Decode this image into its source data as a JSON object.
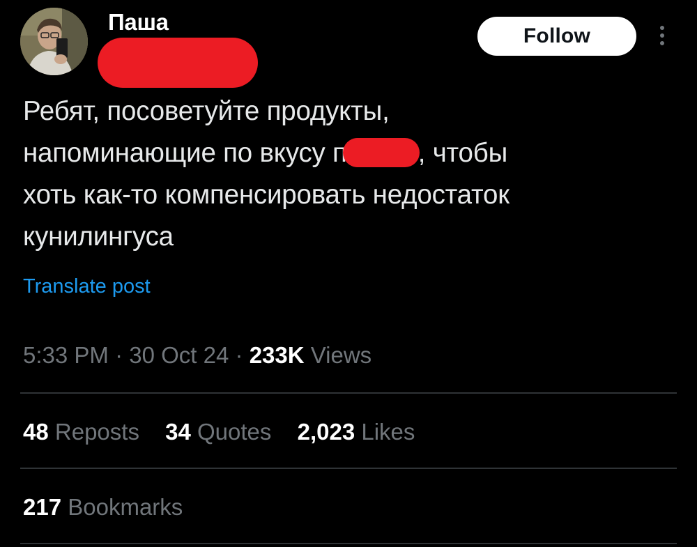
{
  "author": {
    "display_name": "Паша",
    "handle_redacted": true
  },
  "follow_button": {
    "label": "Follow"
  },
  "more_menu": {
    "icon": "more-vertical-icon"
  },
  "tweet": {
    "lines": [
      "Ребят, посоветуйте продукты,",
      "напоминающие по вкусу п",
      ", чтобы",
      "хоть как-то компенсировать недостаток",
      "кунилингуса"
    ]
  },
  "translate": {
    "label": "Translate post"
  },
  "meta": {
    "time": "5:33 PM",
    "separator": "·",
    "date": "30 Oct 24",
    "views_count": "233K",
    "views_label": "Views"
  },
  "stats": {
    "reposts_count": "48",
    "reposts_label": "Reposts",
    "quotes_count": "34",
    "quotes_label": "Quotes",
    "likes_count": "2,023",
    "likes_label": "Likes",
    "bookmarks_count": "217",
    "bookmarks_label": "Bookmarks"
  },
  "colors": {
    "background": "#000000",
    "text": "#e7e9ea",
    "secondary_text": "#71767b",
    "link": "#1d9bf0",
    "divider": "#2f3336",
    "redaction": "#ec1c24"
  }
}
